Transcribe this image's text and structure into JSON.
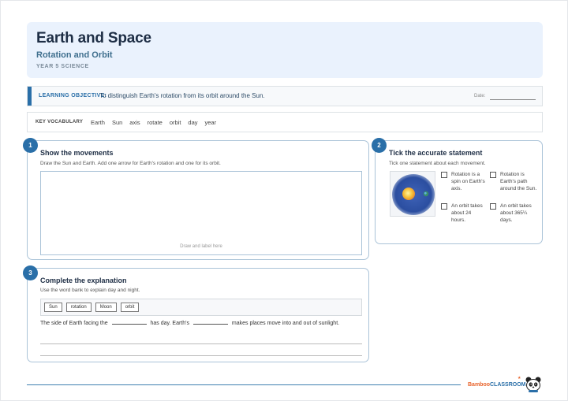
{
  "header": {
    "title": "Earth and Space",
    "subtitle": "Rotation and Orbit",
    "year": "YEAR 5 SCIENCE"
  },
  "objective": {
    "label": "LEARNING OBJECTIVE:",
    "text": "To distinguish Earth's rotation from its orbit around the Sun.",
    "date_label": "Date:"
  },
  "vocab": {
    "label": "KEY VOCABULARY",
    "words": [
      "Earth",
      "Sun",
      "axis",
      "rotate",
      "orbit",
      "day",
      "year"
    ]
  },
  "section1": {
    "number": "1",
    "title": "Show the movements",
    "instruction": "Draw the Sun and Earth. Add one arrow for Earth's rotation and one for its orbit.",
    "hint": "Draw and label here"
  },
  "section2": {
    "number": "2",
    "title": "Tick the accurate statement",
    "instruction": "Tick one statement about each movement.",
    "options": [
      "Rotation is a spin on Earth's axis.",
      "Rotation is Earth's path around the Sun.",
      "An orbit takes about 24 hours.",
      "An orbit takes about 365¼ days."
    ]
  },
  "section3": {
    "number": "3",
    "title": "Complete the explanation",
    "instruction": "Use the word bank to explain day and night.",
    "word_bank": [
      "Sun",
      "rotation",
      "Moon",
      "orbit"
    ],
    "sentence_part1": "The side of Earth facing the",
    "sentence_part2": "has day. Earth's",
    "sentence_part3": "makes places move into and out of sunlight."
  },
  "footer": {
    "brand_part1": "Bamboo",
    "brand_part2": "CLASSROOM"
  },
  "colors": {
    "accent": "#2a6fa8",
    "header_bg": "#eaf2fd",
    "brand_orange": "#e8632b"
  },
  "icons": {
    "planet": "sun-earth-illustration",
    "mascot": "panda-icon"
  }
}
